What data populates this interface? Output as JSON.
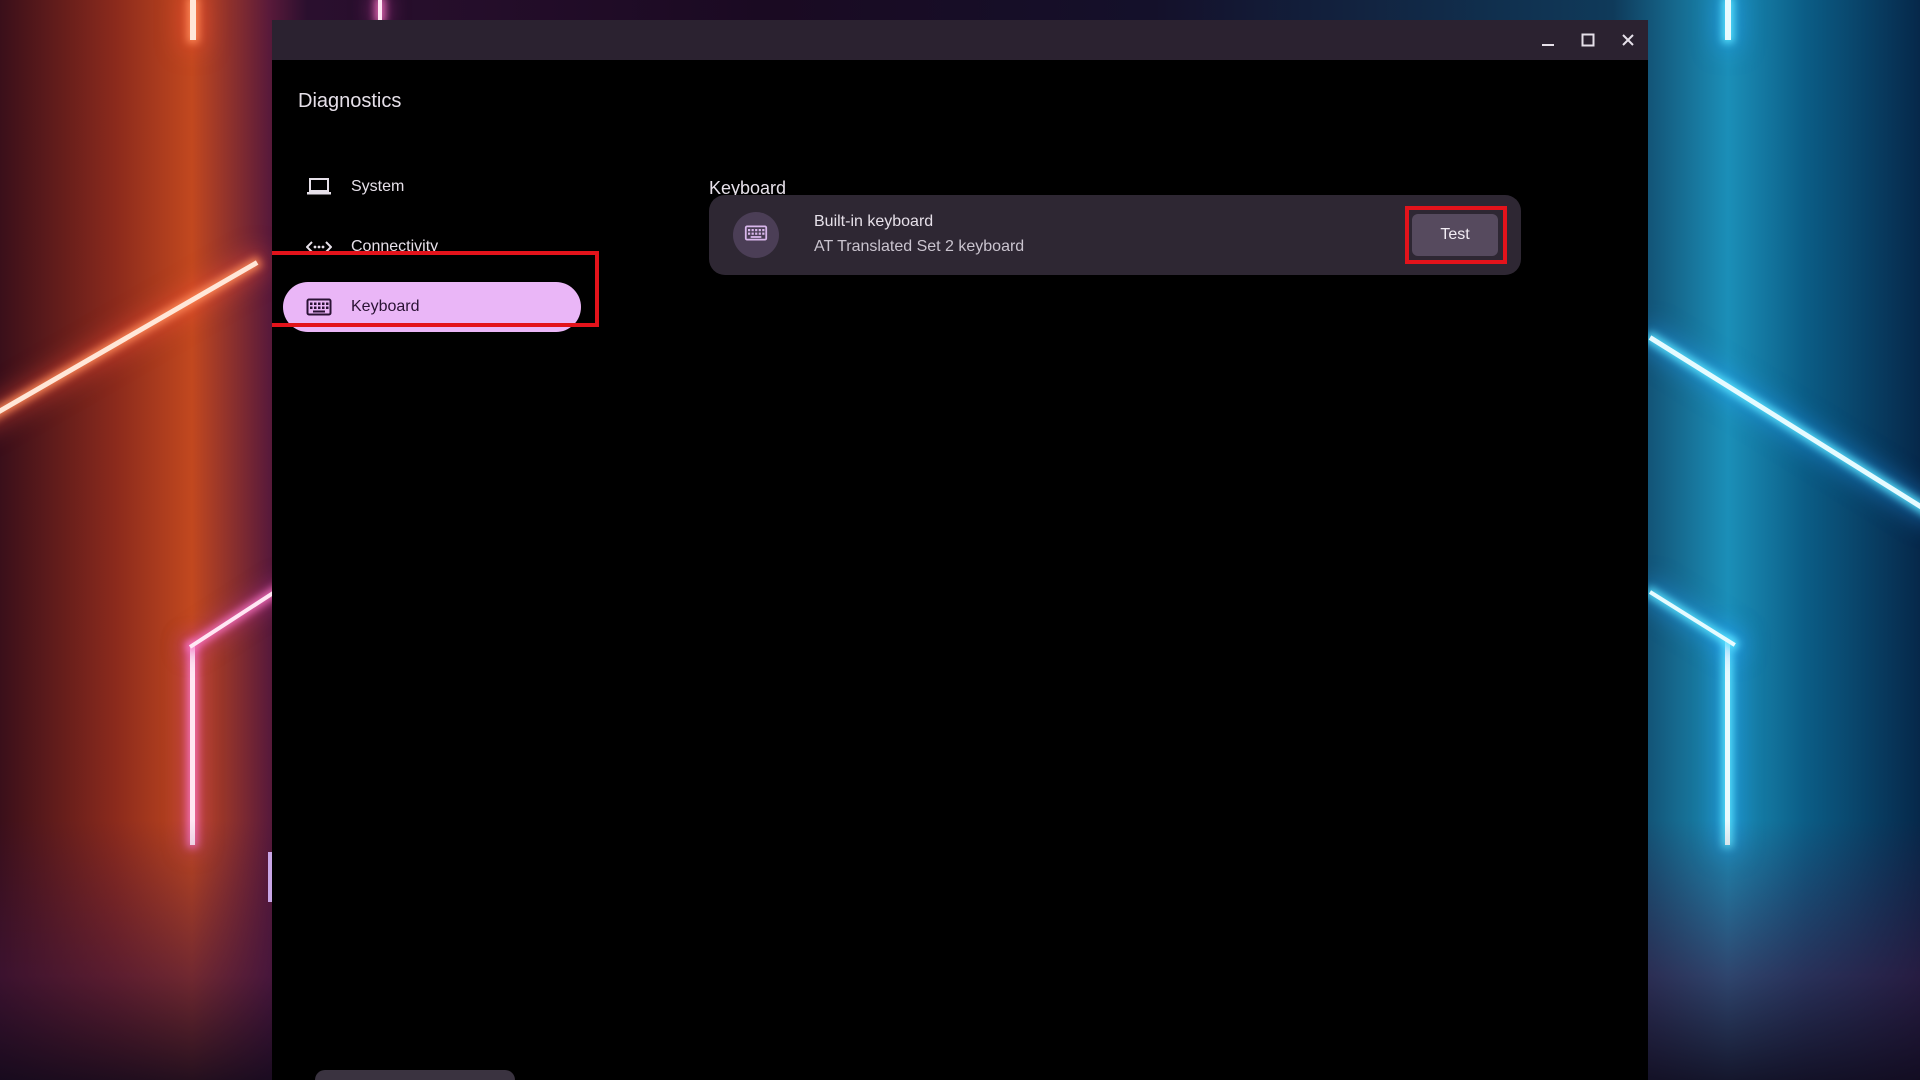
{
  "window": {
    "app_title": "Diagnostics",
    "controls": {
      "minimize": "minimize-icon",
      "maximize": "maximize-icon",
      "close": "close-icon"
    }
  },
  "sidebar": {
    "items": [
      {
        "label": "System",
        "icon": "laptop-icon",
        "active": false
      },
      {
        "label": "Connectivity",
        "icon": "connectivity-icon",
        "active": false
      },
      {
        "label": "Keyboard",
        "icon": "keyboard-icon",
        "active": true
      }
    ]
  },
  "main": {
    "section_title": "Keyboard",
    "device": {
      "icon": "keyboard-icon",
      "name": "Built-in keyboard",
      "subtitle": "AT Translated Set 2 keyboard",
      "test_label": "Test"
    }
  },
  "colors": {
    "active_nav": "#eab6f7",
    "highlight": "#e3131b",
    "card_bg": "#2e2733",
    "window_bg": "#000000",
    "titlebar_bg": "#2b2230"
  }
}
